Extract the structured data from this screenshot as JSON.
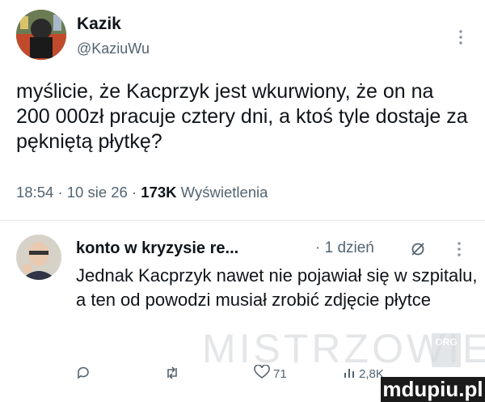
{
  "main_tweet": {
    "author_name": "Kazik",
    "author_handle": "@KaziuWu",
    "text": "myślicie, że Kacprzyk jest wkurwiony, że on na 200 000zł pracuje cztery dni, a ktoś tyle dostaje za pękniętą płytkę?",
    "time": "18:54",
    "date": "10 sie 26",
    "views_count": "173K",
    "views_label": "Wyświetlenia",
    "separator": "·"
  },
  "reply": {
    "author_name": "konto w kryzysie re...",
    "time_ago": "1 dzień",
    "text": "Jednak Kacprzyk nawet nie pojawiał się w szpitalu, a ten od powodzi musiał zrobić zdjęcie płytce",
    "actions": {
      "likes": "71",
      "views": "2,8K"
    }
  },
  "icons": {
    "menu": "more-vertical-icon",
    "grok": "grok-icon",
    "reply": "reply-icon",
    "retweet": "retweet-icon",
    "like": "heart-icon",
    "views": "views-icon",
    "bookmark": "bookmark-icon"
  },
  "watermark": {
    "text": "MISTRZOWIE",
    "badge": "ORG"
  },
  "site_logo": "mdupiu.pl",
  "colors": {
    "text": "#0f1419",
    "muted": "#536471",
    "divider": "#e6e9ea",
    "logo_bg": "#1b1b1b"
  }
}
